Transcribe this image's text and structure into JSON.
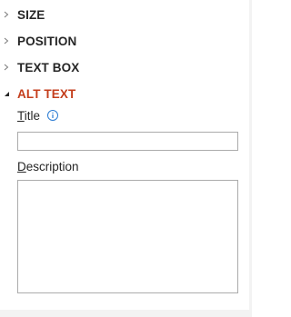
{
  "sections": [
    {
      "label": "SIZE",
      "expanded": false,
      "icon": "chevron-right-icon"
    },
    {
      "label": "POSITION",
      "expanded": false,
      "icon": "chevron-right-icon"
    },
    {
      "label": "TEXT BOX",
      "expanded": false,
      "icon": "chevron-right-icon"
    },
    {
      "label": "ALT TEXT",
      "expanded": true,
      "icon": "expanded-triangle-icon",
      "color": "#c43e1c"
    }
  ],
  "alt_text": {
    "title_label_access": "T",
    "title_label_rest": "itle",
    "title_value": "",
    "description_label_access": "D",
    "description_label_rest": "escription",
    "description_value": "",
    "info_icon": "info-icon"
  },
  "colors": {
    "accent": "#c43e1c",
    "info_blue": "#2b7cd3",
    "border": "#ababab"
  }
}
